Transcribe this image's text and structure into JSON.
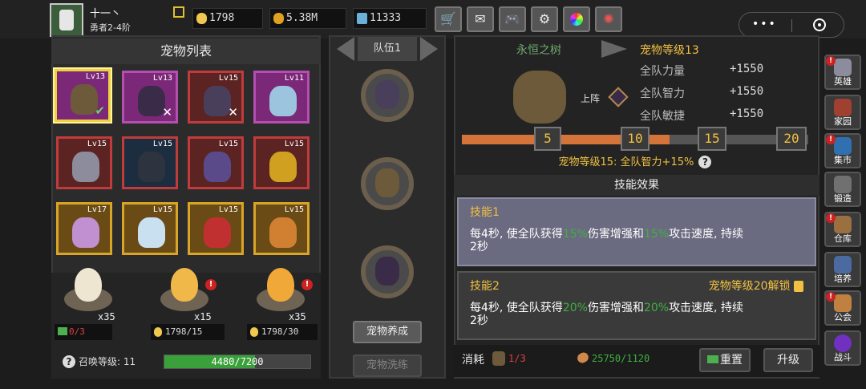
{
  "player": {
    "name": "十一丶",
    "rank": "勇者2-4阶"
  },
  "resources": [
    {
      "icon": "egg-icon",
      "value": "1798"
    },
    {
      "icon": "coin-icon",
      "value": "5.38M"
    },
    {
      "icon": "gem-icon",
      "value": "11333"
    }
  ],
  "toolbar_icons": [
    "cart-icon",
    "mail-icon",
    "gamepad-icon",
    "gear-icon",
    "color-wheel-icon",
    "firework-icon"
  ],
  "pet_list": {
    "title": "宠物列表",
    "pets": [
      {
        "level": "Lv13",
        "rarity": "purple",
        "state": "check"
      },
      {
        "level": "Lv13",
        "rarity": "purple",
        "state": "x"
      },
      {
        "level": "Lv15",
        "rarity": "red",
        "state": "x"
      },
      {
        "level": "Lv11",
        "rarity": "purple",
        "state": ""
      },
      {
        "level": "Lv15",
        "rarity": "red",
        "state": ""
      },
      {
        "level": "Lv15",
        "rarity": "blue",
        "state": ""
      },
      {
        "level": "Lv15",
        "rarity": "red",
        "state": ""
      },
      {
        "level": "Lv15",
        "rarity": "red",
        "state": ""
      },
      {
        "level": "Lv17",
        "rarity": "gold",
        "state": ""
      },
      {
        "level": "Lv15",
        "rarity": "gold",
        "state": ""
      },
      {
        "level": "Lv15",
        "rarity": "gold",
        "state": ""
      },
      {
        "level": "Lv15",
        "rarity": "gold",
        "state": ""
      }
    ],
    "eggs": [
      {
        "count": "x35",
        "cost": "0/3",
        "cost_type": "video"
      },
      {
        "count": "x15",
        "cost": "1798/15",
        "cost_type": "egg"
      },
      {
        "count": "x35",
        "cost": "1798/30",
        "cost_type": "egg"
      }
    ],
    "summon_label": "召唤等级: 11",
    "summon_progress": "4480/7200",
    "summon_fraction": 0.622
  },
  "team": {
    "label": "队伍1",
    "train_button": "宠物养成",
    "wash_button": "宠物洗练"
  },
  "pet_detail": {
    "name": "永恒之树",
    "level_label": "宠物等级13",
    "deploy_label": "上阵",
    "stats": [
      {
        "label": "全队力量",
        "value": "+1550"
      },
      {
        "label": "全队智力",
        "value": "+1550"
      },
      {
        "label": "全队敏捷",
        "value": "+1550"
      }
    ],
    "milestones": [
      "5",
      "10",
      "15",
      "20"
    ],
    "progress_fraction": 0.6,
    "bonus": "宠物等级15: 全队智力+15%",
    "skills_title": "技能效果",
    "skill1": {
      "name": "技能1",
      "desc_a": "每4秒, 使全队获得",
      "pct1": "15%",
      "desc_b": "伤害增强和",
      "pct2": "15%",
      "desc_c": "攻击速度, 持续",
      "desc_d": "2秒"
    },
    "skill2": {
      "name": "技能2",
      "unlock": "宠物等级20解锁",
      "desc_a": "每4秒, 使全队获得",
      "pct1": "20%",
      "desc_b": "伤害增强和",
      "pct2": "20%",
      "desc_c": "攻击速度, 持续",
      "desc_d": "2秒"
    },
    "consume_label": "消耗",
    "consume_pet": "1/3",
    "consume_bone": "25750/1120",
    "reset_button": "重置",
    "upgrade_button": "升级"
  },
  "side_menu": [
    {
      "label": "英雄",
      "icon": "hero-helmet-icon",
      "badge": true
    },
    {
      "label": "家园",
      "icon": "castle-icon",
      "badge": false
    },
    {
      "label": "集市",
      "icon": "market-icon",
      "badge": true
    },
    {
      "label": "锻造",
      "icon": "anvil-icon",
      "badge": false
    },
    {
      "label": "仓库",
      "icon": "warehouse-icon",
      "badge": true
    },
    {
      "label": "培养",
      "icon": "training-icon",
      "badge": false
    },
    {
      "label": "公会",
      "icon": "guild-icon",
      "badge": true
    },
    {
      "label": "战斗",
      "icon": "battle-portal-icon",
      "badge": false
    }
  ]
}
